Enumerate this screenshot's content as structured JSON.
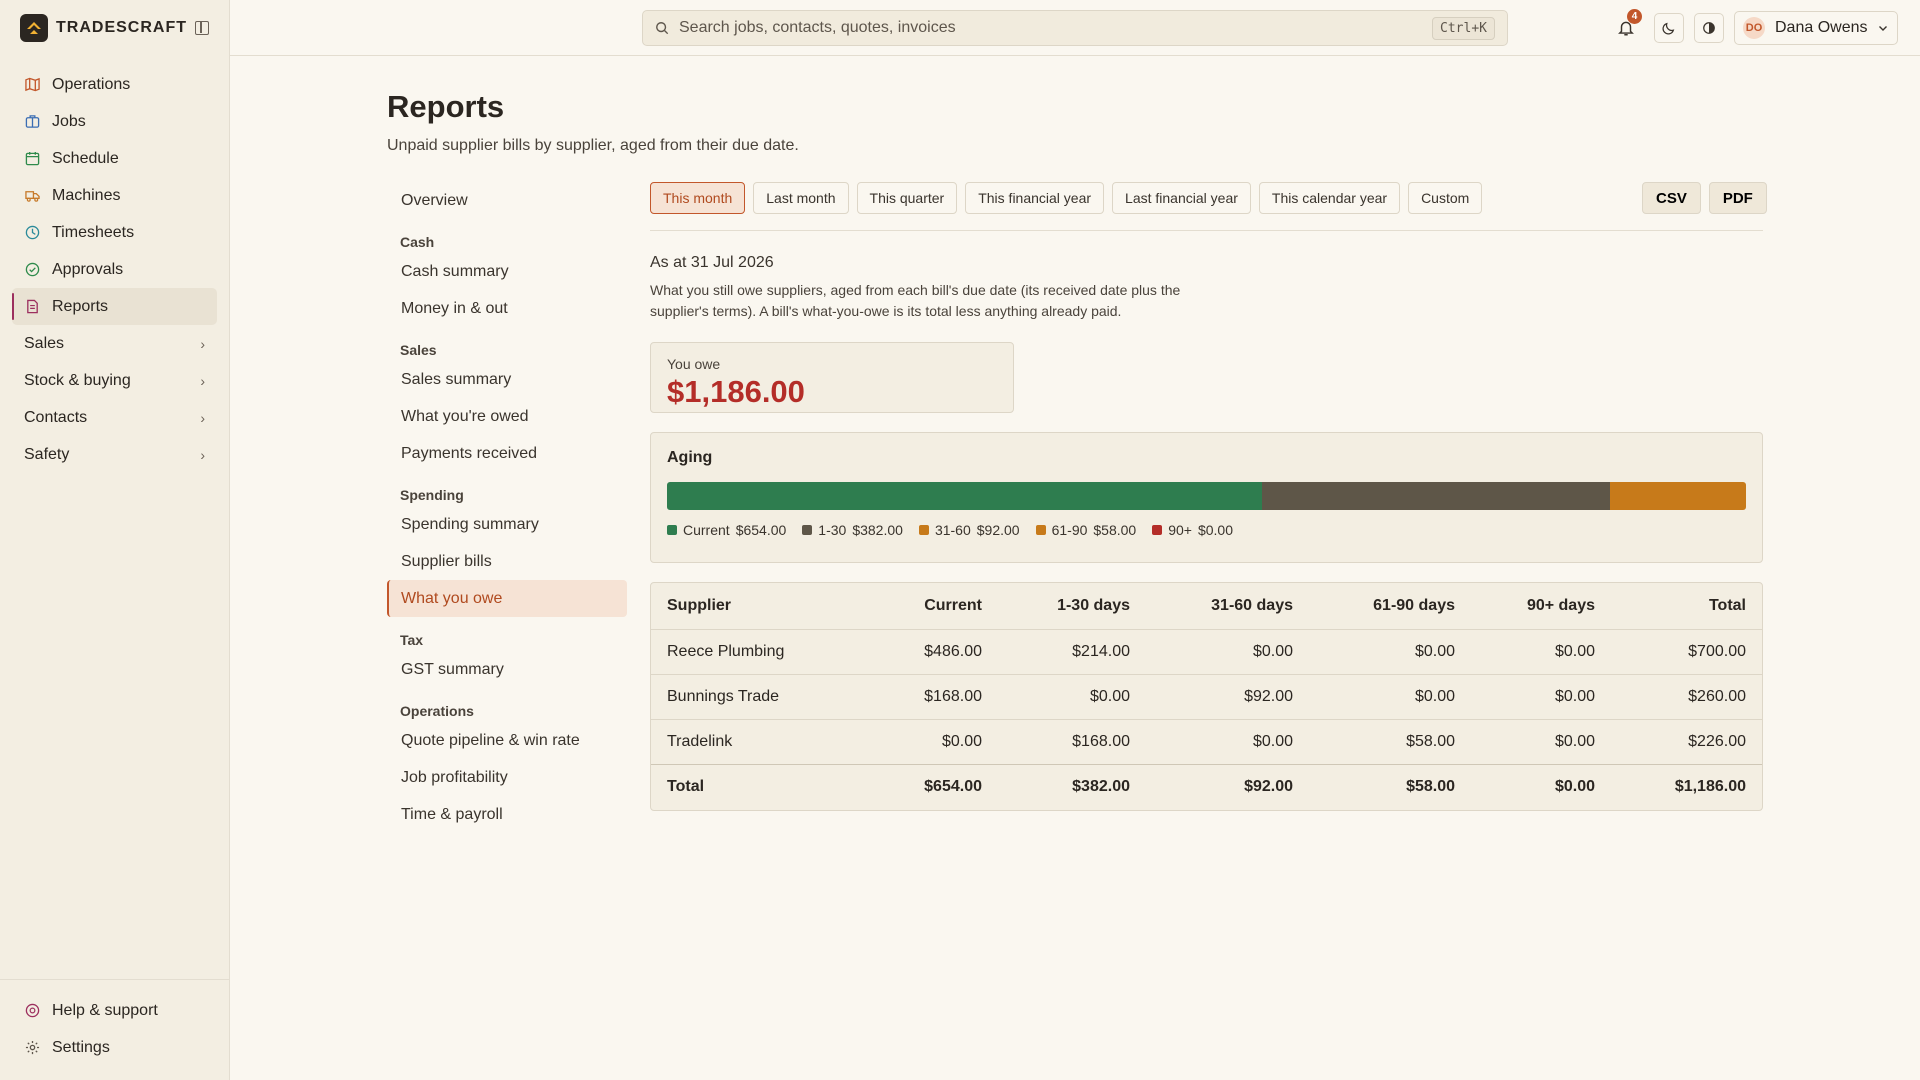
{
  "app": {
    "brand": "TRADESCRAFT",
    "accent": "#c2572b"
  },
  "sidebar": {
    "items": [
      {
        "label": "Operations",
        "icon": "map-icon",
        "color": "#c2572b"
      },
      {
        "label": "Jobs",
        "icon": "briefcase-icon",
        "color": "#3b6db3"
      },
      {
        "label": "Schedule",
        "icon": "calendar-icon",
        "color": "#2e8a4b"
      },
      {
        "label": "Machines",
        "icon": "truck-icon",
        "color": "#c77a2a"
      },
      {
        "label": "Timesheets",
        "icon": "clock-icon",
        "color": "#2a8a9a"
      },
      {
        "label": "Approvals",
        "icon": "check-circle-icon",
        "color": "#2e8a4b"
      },
      {
        "label": "Reports",
        "icon": "document-icon",
        "color": "#9c2f5e"
      }
    ],
    "groups": [
      {
        "label": "Sales"
      },
      {
        "label": "Stock & buying"
      },
      {
        "label": "Contacts"
      },
      {
        "label": "Safety"
      }
    ],
    "bottom": [
      {
        "label": "Help & support",
        "icon": "help-icon",
        "color": "#9c2f5e"
      },
      {
        "label": "Settings",
        "icon": "gear-icon",
        "color": "#5e564c"
      }
    ]
  },
  "header": {
    "search_placeholder": "Search jobs, contacts, quotes, invoices",
    "shortcut": "Ctrl+K",
    "notification_count": "4",
    "user_initials": "DO",
    "user_name": "Dana Owens"
  },
  "page": {
    "title": "Reports",
    "subtitle": "Unpaid supplier bills by supplier, aged from their due date."
  },
  "subnav": {
    "overview": "Overview",
    "sections": [
      {
        "heading": "Cash",
        "items": [
          "Cash summary",
          "Money in & out"
        ]
      },
      {
        "heading": "Sales",
        "items": [
          "Sales summary",
          "What you're owed",
          "Payments received"
        ]
      },
      {
        "heading": "Spending",
        "items": [
          "Spending summary",
          "Supplier bills",
          "What you owe"
        ]
      },
      {
        "heading": "Tax",
        "items": [
          "GST summary"
        ]
      },
      {
        "heading": "Operations",
        "items": [
          "Quote pipeline & win rate",
          "Job profitability",
          "Time & payroll"
        ]
      }
    ],
    "active": "What you owe"
  },
  "filters": {
    "periods": [
      "This month",
      "Last month",
      "This quarter",
      "This financial year",
      "Last financial year",
      "This calendar year",
      "Custom"
    ],
    "active": "This month",
    "exports": [
      "CSV",
      "PDF"
    ]
  },
  "report": {
    "as_at": "As at 31 Jul 2026",
    "explanation": "What you still owe suppliers, aged from each bill's due date (its received date plus the supplier's terms). A bill's what-you-owe is its total less anything already paid.",
    "you_owe_label": "You owe",
    "you_owe_value": "$1,186.00"
  },
  "aging": {
    "title": "Aging",
    "buckets": [
      {
        "label": "Current",
        "amount": "$654.00",
        "value": 654,
        "color": "#2e7d4f"
      },
      {
        "label": "1-30",
        "amount": "$382.00",
        "value": 382,
        "color": "#5e5648"
      },
      {
        "label": "31-60",
        "amount": "$92.00",
        "value": 92,
        "color": "#c77a1a"
      },
      {
        "label": "61-90",
        "amount": "$58.00",
        "value": 58,
        "color": "#c77a1a"
      },
      {
        "label": "90+",
        "amount": "$0.00",
        "value": 0,
        "color": "#b42d28"
      }
    ]
  },
  "table": {
    "columns": [
      "Supplier",
      "Current",
      "1-30 days",
      "31-60 days",
      "61-90 days",
      "90+ days",
      "Total"
    ],
    "rows": [
      [
        "Reece Plumbing",
        "$486.00",
        "$214.00",
        "$0.00",
        "$0.00",
        "$0.00",
        "$700.00"
      ],
      [
        "Bunnings Trade",
        "$168.00",
        "$0.00",
        "$92.00",
        "$0.00",
        "$0.00",
        "$260.00"
      ],
      [
        "Tradelink",
        "$0.00",
        "$168.00",
        "$0.00",
        "$58.00",
        "$0.00",
        "$226.00"
      ]
    ],
    "total": [
      "Total",
      "$654.00",
      "$382.00",
      "$92.00",
      "$58.00",
      "$0.00",
      "$1,186.00"
    ]
  }
}
